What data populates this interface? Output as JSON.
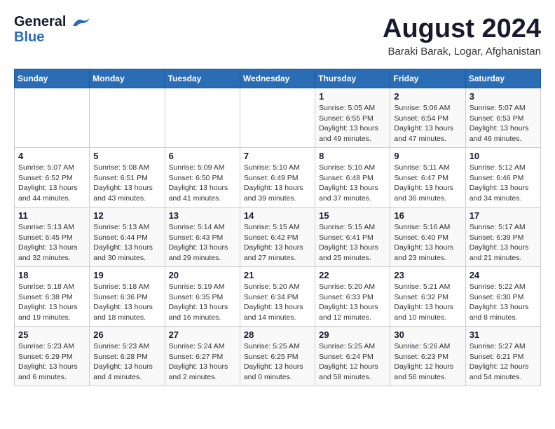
{
  "header": {
    "logo_line1": "General",
    "logo_line2": "Blue",
    "month": "August 2024",
    "location": "Baraki Barak, Logar, Afghanistan"
  },
  "weekdays": [
    "Sunday",
    "Monday",
    "Tuesday",
    "Wednesday",
    "Thursday",
    "Friday",
    "Saturday"
  ],
  "weeks": [
    [
      {
        "day": "",
        "info": ""
      },
      {
        "day": "",
        "info": ""
      },
      {
        "day": "",
        "info": ""
      },
      {
        "day": "",
        "info": ""
      },
      {
        "day": "1",
        "info": "Sunrise: 5:05 AM\nSunset: 6:55 PM\nDaylight: 13 hours\nand 49 minutes."
      },
      {
        "day": "2",
        "info": "Sunrise: 5:06 AM\nSunset: 6:54 PM\nDaylight: 13 hours\nand 47 minutes."
      },
      {
        "day": "3",
        "info": "Sunrise: 5:07 AM\nSunset: 6:53 PM\nDaylight: 13 hours\nand 46 minutes."
      }
    ],
    [
      {
        "day": "4",
        "info": "Sunrise: 5:07 AM\nSunset: 6:52 PM\nDaylight: 13 hours\nand 44 minutes."
      },
      {
        "day": "5",
        "info": "Sunrise: 5:08 AM\nSunset: 6:51 PM\nDaylight: 13 hours\nand 43 minutes."
      },
      {
        "day": "6",
        "info": "Sunrise: 5:09 AM\nSunset: 6:50 PM\nDaylight: 13 hours\nand 41 minutes."
      },
      {
        "day": "7",
        "info": "Sunrise: 5:10 AM\nSunset: 6:49 PM\nDaylight: 13 hours\nand 39 minutes."
      },
      {
        "day": "8",
        "info": "Sunrise: 5:10 AM\nSunset: 6:48 PM\nDaylight: 13 hours\nand 37 minutes."
      },
      {
        "day": "9",
        "info": "Sunrise: 5:11 AM\nSunset: 6:47 PM\nDaylight: 13 hours\nand 36 minutes."
      },
      {
        "day": "10",
        "info": "Sunrise: 5:12 AM\nSunset: 6:46 PM\nDaylight: 13 hours\nand 34 minutes."
      }
    ],
    [
      {
        "day": "11",
        "info": "Sunrise: 5:13 AM\nSunset: 6:45 PM\nDaylight: 13 hours\nand 32 minutes."
      },
      {
        "day": "12",
        "info": "Sunrise: 5:13 AM\nSunset: 6:44 PM\nDaylight: 13 hours\nand 30 minutes."
      },
      {
        "day": "13",
        "info": "Sunrise: 5:14 AM\nSunset: 6:43 PM\nDaylight: 13 hours\nand 29 minutes."
      },
      {
        "day": "14",
        "info": "Sunrise: 5:15 AM\nSunset: 6:42 PM\nDaylight: 13 hours\nand 27 minutes."
      },
      {
        "day": "15",
        "info": "Sunrise: 5:15 AM\nSunset: 6:41 PM\nDaylight: 13 hours\nand 25 minutes."
      },
      {
        "day": "16",
        "info": "Sunrise: 5:16 AM\nSunset: 6:40 PM\nDaylight: 13 hours\nand 23 minutes."
      },
      {
        "day": "17",
        "info": "Sunrise: 5:17 AM\nSunset: 6:39 PM\nDaylight: 13 hours\nand 21 minutes."
      }
    ],
    [
      {
        "day": "18",
        "info": "Sunrise: 5:18 AM\nSunset: 6:38 PM\nDaylight: 13 hours\nand 19 minutes."
      },
      {
        "day": "19",
        "info": "Sunrise: 5:18 AM\nSunset: 6:36 PM\nDaylight: 13 hours\nand 18 minutes."
      },
      {
        "day": "20",
        "info": "Sunrise: 5:19 AM\nSunset: 6:35 PM\nDaylight: 13 hours\nand 16 minutes."
      },
      {
        "day": "21",
        "info": "Sunrise: 5:20 AM\nSunset: 6:34 PM\nDaylight: 13 hours\nand 14 minutes."
      },
      {
        "day": "22",
        "info": "Sunrise: 5:20 AM\nSunset: 6:33 PM\nDaylight: 13 hours\nand 12 minutes."
      },
      {
        "day": "23",
        "info": "Sunrise: 5:21 AM\nSunset: 6:32 PM\nDaylight: 13 hours\nand 10 minutes."
      },
      {
        "day": "24",
        "info": "Sunrise: 5:22 AM\nSunset: 6:30 PM\nDaylight: 13 hours\nand 8 minutes."
      }
    ],
    [
      {
        "day": "25",
        "info": "Sunrise: 5:23 AM\nSunset: 6:29 PM\nDaylight: 13 hours\nand 6 minutes."
      },
      {
        "day": "26",
        "info": "Sunrise: 5:23 AM\nSunset: 6:28 PM\nDaylight: 13 hours\nand 4 minutes."
      },
      {
        "day": "27",
        "info": "Sunrise: 5:24 AM\nSunset: 6:27 PM\nDaylight: 13 hours\nand 2 minutes."
      },
      {
        "day": "28",
        "info": "Sunrise: 5:25 AM\nSunset: 6:25 PM\nDaylight: 13 hours\nand 0 minutes."
      },
      {
        "day": "29",
        "info": "Sunrise: 5:25 AM\nSunset: 6:24 PM\nDaylight: 12 hours\nand 58 minutes."
      },
      {
        "day": "30",
        "info": "Sunrise: 5:26 AM\nSunset: 6:23 PM\nDaylight: 12 hours\nand 56 minutes."
      },
      {
        "day": "31",
        "info": "Sunrise: 5:27 AM\nSunset: 6:21 PM\nDaylight: 12 hours\nand 54 minutes."
      }
    ]
  ]
}
